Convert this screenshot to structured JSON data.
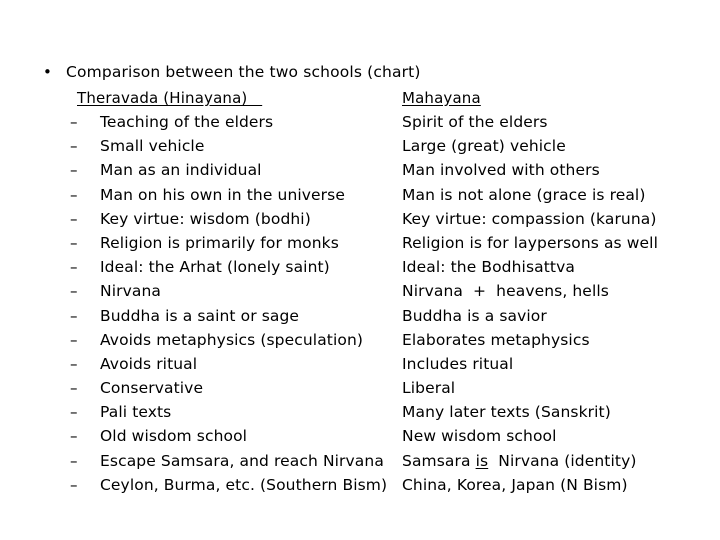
{
  "slide": {
    "bullet_glyph": "•",
    "dash_glyph": "–",
    "title": "Comparison between the two schools (chart)",
    "background_color": "#ffffff",
    "text_color": "#000000"
  },
  "columns": {
    "left_heading": "Theravada (Hinayana)   ",
    "right_heading": "Mahayana"
  },
  "rows": [
    {
      "left": "Teaching of the elders",
      "right": "Spirit of the elders"
    },
    {
      "left": "Small vehicle",
      "right": "Large (great) vehicle"
    },
    {
      "left": "Man as an individual",
      "right": "Man involved with others"
    },
    {
      "left": "Man on his own in the universe",
      "right": "Man is not alone (grace is real)"
    },
    {
      "left": "Key virtue: wisdom (bodhi)",
      "right": "Key virtue: compassion (karuna)"
    },
    {
      "left": "Religion is primarily for monks",
      "right": "Religion is for laypersons as well"
    },
    {
      "left": "Ideal: the Arhat (lonely saint)",
      "right": "Ideal: the Bodhisattva"
    },
    {
      "left": "Nirvana",
      "right": "Nirvana  +  heavens, hells"
    },
    {
      "left": "Buddha is a saint or sage",
      "right": "Buddha is a savior"
    },
    {
      "left": "Avoids metaphysics (speculation)",
      "right": "Elaborates metaphysics"
    },
    {
      "left": "Avoids ritual",
      "right": "Includes ritual"
    },
    {
      "left": "Conservative",
      "right": "Liberal"
    },
    {
      "left": "Pali texts",
      "right": "Many later texts (Sanskrit)"
    },
    {
      "left": "Old wisdom school",
      "right": "New wisdom school"
    },
    {
      "left": "Escape Samsara, and reach Nirvana",
      "right_parts": [
        {
          "text": "Samsara "
        },
        {
          "text": "is",
          "underline": true
        },
        {
          "text": "  Nirvana (identity)"
        }
      ]
    },
    {
      "left": "Ceylon, Burma, etc. (Southern Bism)",
      "right": "China, Korea, Japan (N Bism)"
    }
  ]
}
